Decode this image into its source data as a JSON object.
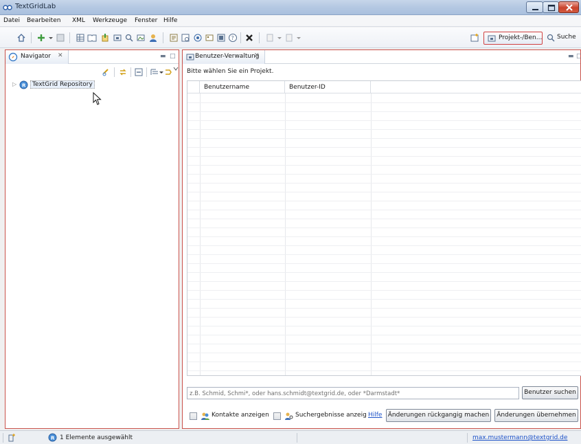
{
  "window": {
    "title": "TextGridLab"
  },
  "menu": [
    "Datei",
    "Bearbeiten",
    "XML",
    "Werkzeuge",
    "Fenster",
    "Hilfe"
  ],
  "perspectives": {
    "active_label": "Projekt-/Ben...",
    "search_label": "Suche"
  },
  "navigator": {
    "tab_label": "Navigator",
    "tab_close": "✕",
    "tree": [
      {
        "label": "TextGrid Repository",
        "expanded": false
      }
    ]
  },
  "user_management": {
    "tab_label": "Benutzer-Verwaltung",
    "tab_close": "✕",
    "hint": "Bitte wählen Sie ein Projekt.",
    "columns": [
      "Benutzername",
      "Benutzer-ID"
    ],
    "rows": [],
    "search_placeholder": "z.B. Schmid, Schmi*, oder hans.schmidt@textgrid.de, oder *Darmstadt*",
    "search_button": "Benutzer suchen",
    "show_contacts_label": "Kontakte anzeigen",
    "show_results_label": "Suchergebnisse anzeige",
    "help_label": "Hilfe",
    "undo_button": "Änderungen rückgangig machen",
    "apply_button": "Änderungen übernehmen"
  },
  "status": {
    "selection": "1 Elemente ausgewählt",
    "user": "max.mustermann@textgrid.de"
  }
}
